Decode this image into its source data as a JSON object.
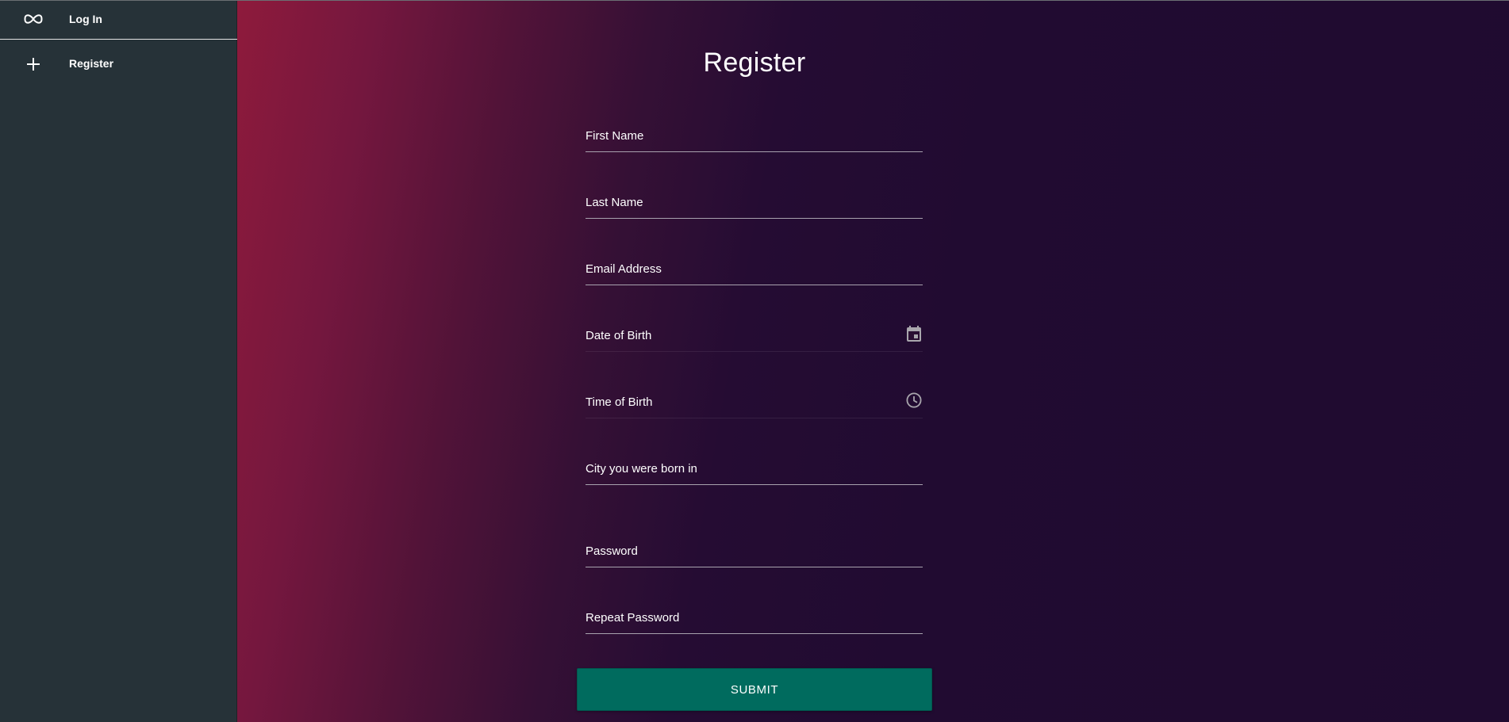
{
  "sidebar": {
    "items": [
      {
        "label": "Log In",
        "icon": "infinity-icon"
      },
      {
        "label": "Register",
        "icon": "plus-icon"
      }
    ]
  },
  "form": {
    "title": "Register",
    "fields": [
      {
        "label": "First Name"
      },
      {
        "label": "Last Name"
      },
      {
        "label": "Email Address"
      },
      {
        "label": "Date of Birth",
        "icon": "calendar-icon"
      },
      {
        "label": "Time of Birth",
        "icon": "clock-icon"
      },
      {
        "label": "City you were born in"
      },
      {
        "label": "Password"
      },
      {
        "label": "Repeat Password"
      }
    ],
    "submit_label": "SUBMIT"
  },
  "colors": {
    "sidebar_bg": "#263238",
    "gradient_start": "#8e1a3c",
    "gradient_end": "#1f0b30",
    "button_bg": "#006b5e"
  }
}
